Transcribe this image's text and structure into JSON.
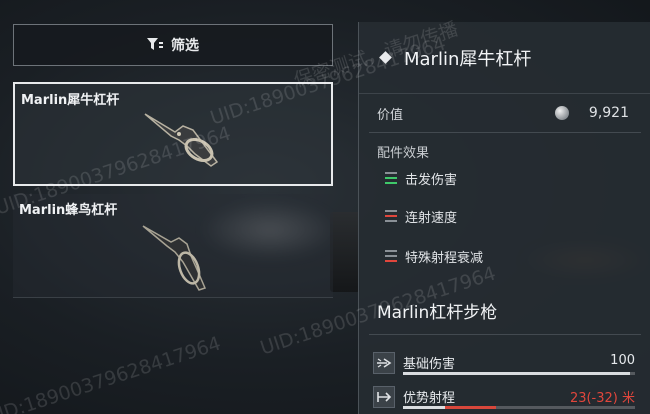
{
  "filter": {
    "label": "筛选"
  },
  "items": [
    {
      "name": "Marlin犀牛杠杆",
      "selected": true
    },
    {
      "name": "Marlin蜂鸟杠杆",
      "selected": false
    }
  ],
  "detail": {
    "title": "Marlin犀牛杠杆",
    "value_label": "价值",
    "value": "9,921",
    "effects_title": "配件效果",
    "effects": [
      {
        "label": "击发伤害",
        "icon": "stat-up-green-icon",
        "color": "#3fc96a"
      },
      {
        "label": "连射速度",
        "icon": "stat-down-red-icon",
        "color": "#e0463c"
      },
      {
        "label": "特殊射程衰减",
        "icon": "stat-down-red-icon",
        "color": "#e0463c"
      }
    ],
    "weapon_title": "Marlin杠杆步枪",
    "stats": [
      {
        "label": "基础伤害",
        "value": "100",
        "fill": 0.98,
        "icon": "damage-icon"
      },
      {
        "label": "优势射程",
        "value": "23(-32) 米",
        "fill": 0.18,
        "neg_fill": 0.22,
        "icon": "range-icon"
      }
    ]
  },
  "watermark": {
    "line1": "保密测试，请勿传播",
    "line2": "UID:18900379628417964"
  }
}
